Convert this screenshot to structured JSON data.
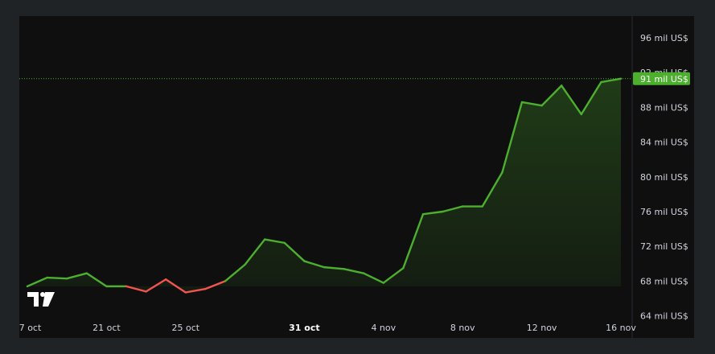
{
  "colors": {
    "up": "#4caf2e",
    "down": "#f2554f",
    "area": "#4caf2e",
    "last_price_bg": "#4caf2e",
    "background": "#0f0f0f",
    "frame": "#1f2326",
    "text": "#d1d4dc"
  },
  "logo_icon": "tradingview-logo-icon",
  "chart_data": {
    "type": "area",
    "title": "",
    "xlabel": "",
    "ylabel": "",
    "ylim": [
      63.5,
      98.5
    ],
    "x_domain": [
      "2024-10-17",
      "2024-11-16"
    ],
    "grid": false,
    "y_ticks": [
      {
        "value": 64,
        "label": "64 mil US$"
      },
      {
        "value": 68,
        "label": "68 mil US$"
      },
      {
        "value": 72,
        "label": "72 mil US$"
      },
      {
        "value": 76,
        "label": "76 mil US$"
      },
      {
        "value": 80,
        "label": "80 mil US$"
      },
      {
        "value": 84,
        "label": "84 mil US$"
      },
      {
        "value": 88,
        "label": "88 mil US$"
      },
      {
        "value": 92,
        "label": "92 mil US$"
      },
      {
        "value": 96,
        "label": "96 mil US$"
      }
    ],
    "x_ticks": [
      {
        "date": "2024-10-17",
        "label": "17 oct",
        "bold": false
      },
      {
        "date": "2024-10-21",
        "label": "21 oct",
        "bold": false
      },
      {
        "date": "2024-10-25",
        "label": "25 oct",
        "bold": false
      },
      {
        "date": "2024-10-31",
        "label": "31 oct",
        "bold": true
      },
      {
        "date": "2024-11-04",
        "label": "4 nov",
        "bold": false
      },
      {
        "date": "2024-11-08",
        "label": "8 nov",
        "bold": false
      },
      {
        "date": "2024-11-12",
        "label": "12 nov",
        "bold": false
      },
      {
        "date": "2024-11-16",
        "label": "16 nov",
        "bold": false
      }
    ],
    "last_price": {
      "value": 91.3,
      "label": "91 mil US$"
    },
    "series": [
      {
        "x": [
          "2024-10-17",
          "2024-10-18",
          "2024-10-19",
          "2024-10-20",
          "2024-10-21",
          "2024-10-22",
          "2024-10-23",
          "2024-10-24",
          "2024-10-25",
          "2024-10-26",
          "2024-10-27",
          "2024-10-28",
          "2024-10-29",
          "2024-10-30",
          "2024-10-31",
          "2024-11-01",
          "2024-11-02",
          "2024-11-03",
          "2024-11-04",
          "2024-11-05",
          "2024-11-06",
          "2024-11-07",
          "2024-11-08",
          "2024-11-09",
          "2024-11-10",
          "2024-11-11",
          "2024-11-12",
          "2024-11-13",
          "2024-11-14",
          "2024-11-15",
          "2024-11-16"
        ],
        "values": [
          67.4,
          68.4,
          68.3,
          68.9,
          67.4,
          67.4,
          66.8,
          68.2,
          66.7,
          67.1,
          68.0,
          69.9,
          72.8,
          72.4,
          70.3,
          69.6,
          69.4,
          68.9,
          67.8,
          69.5,
          75.7,
          76.0,
          76.6,
          76.6,
          80.5,
          88.6,
          88.2,
          90.5,
          87.2,
          90.9,
          91.3
        ]
      }
    ]
  }
}
